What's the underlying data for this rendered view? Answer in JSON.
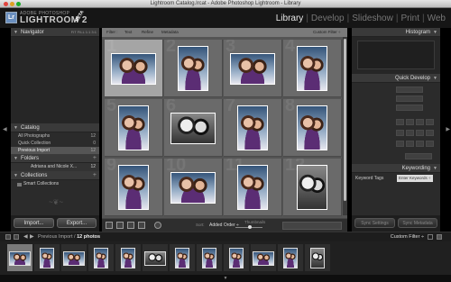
{
  "window": {
    "title": "Lightroom Catalog.lrcat - Adobe Photoshop Lightroom - Library"
  },
  "brand": {
    "company": "ADOBE PHOTOSHOP",
    "product": "LIGHTROOM 2",
    "badge": "BETA",
    "logo_letters": "Lr"
  },
  "modules": [
    "Library",
    "Develop",
    "Slideshow",
    "Print",
    "Web"
  ],
  "active_module": "Library",
  "left_panel": {
    "navigator": {
      "title": "Navigator",
      "zoom_options": "FIT  FILL  1:1  3:1"
    },
    "catalog": {
      "title": "Catalog",
      "items": [
        {
          "label": "All Photographs",
          "count": "12"
        },
        {
          "label": "Quick Collection",
          "count": "0"
        },
        {
          "label": "Previous Import",
          "count": "12",
          "selected": true
        }
      ]
    },
    "folders": {
      "title": "Folders",
      "items": [
        {
          "label": "Adriana and Nicole X...",
          "count": "12"
        }
      ]
    },
    "collections": {
      "title": "Collections",
      "items": [
        {
          "label": "Smart Collections"
        }
      ]
    },
    "buttons": {
      "import": "Import...",
      "export": "Export..."
    }
  },
  "filter_bar": {
    "items": [
      "Filter :",
      "Text",
      "Refine",
      "Metadata"
    ],
    "custom_filter": "Custom Filter ÷"
  },
  "toolbar": {
    "sort_label": "Sort:",
    "sort_value": "Added Order ÷",
    "thumbnails_label": "Thumbnails"
  },
  "right_panel": {
    "histogram": "Histogram",
    "quick_develop": "Quick Develop",
    "keywording": "Keywording",
    "keyword_tags_label": "Keyword Tags",
    "keyword_tags_value": "Enter Keywords ÷",
    "buttons": {
      "sync_settings": "Sync Settings",
      "sync_metadata": "Sync Metadata"
    }
  },
  "filmstrip_bar": {
    "source_prefix": "Previous Import /",
    "source_count": "12 photos",
    "custom_filter": "Custom Filter ÷"
  },
  "colors": {
    "accent_active_module": "#e8e8e8",
    "panel_bg": "#2b2b2b",
    "grid_bg": "#545454"
  },
  "grid": {
    "selected_index": 0,
    "photos": [
      {
        "num": "1",
        "orient": "landscape",
        "tone": "color"
      },
      {
        "num": "2",
        "orient": "portrait",
        "tone": "color"
      },
      {
        "num": "3",
        "orient": "landscape",
        "tone": "color"
      },
      {
        "num": "4",
        "orient": "portrait",
        "tone": "color"
      },
      {
        "num": "5",
        "orient": "portrait",
        "tone": "color"
      },
      {
        "num": "6",
        "orient": "landscape",
        "tone": "bw"
      },
      {
        "num": "7",
        "orient": "portrait",
        "tone": "color"
      },
      {
        "num": "8",
        "orient": "portrait",
        "tone": "color"
      },
      {
        "num": "9",
        "orient": "portrait",
        "tone": "color"
      },
      {
        "num": "10",
        "orient": "landscape",
        "tone": "color"
      },
      {
        "num": "11",
        "orient": "portrait",
        "tone": "color"
      },
      {
        "num": "12",
        "orient": "portrait",
        "tone": "bw"
      }
    ]
  }
}
